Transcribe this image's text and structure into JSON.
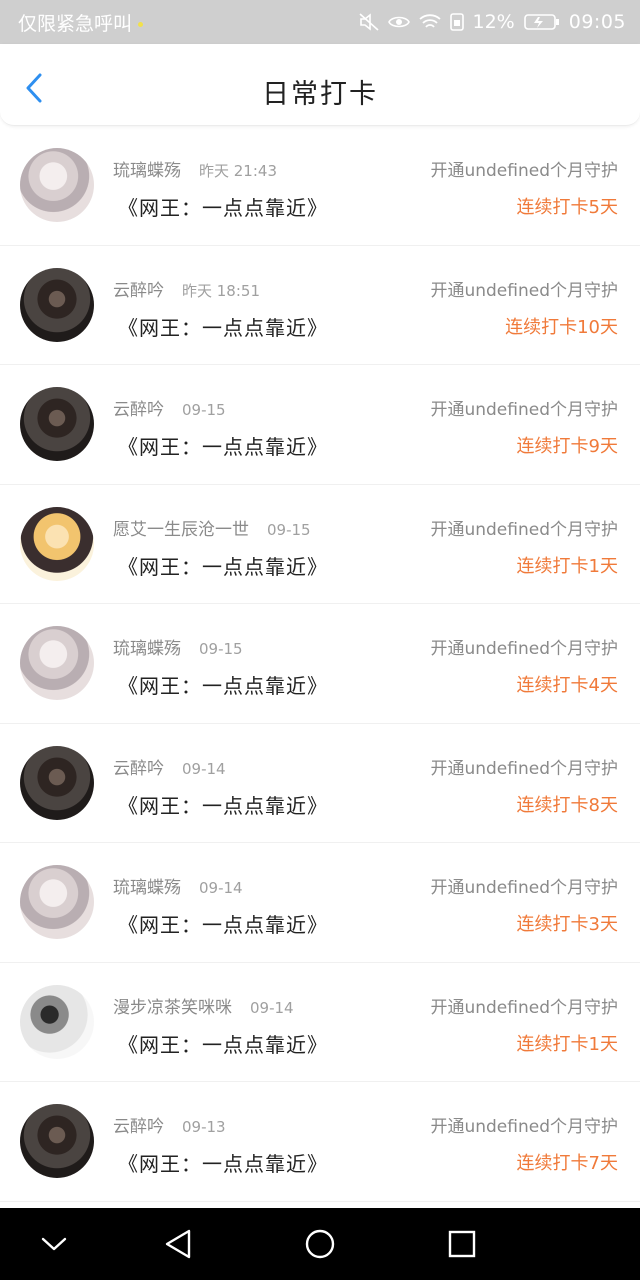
{
  "status_bar": {
    "carrier": "仅限紧急呼叫",
    "battery": "12%",
    "time": "09:05"
  },
  "header": {
    "title": "日常打卡",
    "back_icon": "chevron-left-icon"
  },
  "rows": [
    {
      "user": "琉璃蝶殇",
      "time": "昨天 21:43",
      "guard": "开通undefined个月守护",
      "book": "《网王：一点点靠近》",
      "streak": "连续打卡5天",
      "avatar": "style-1"
    },
    {
      "user": "云醉吟",
      "time": "昨天 18:51",
      "guard": "开通undefined个月守护",
      "book": "《网王：一点点靠近》",
      "streak": "连续打卡10天",
      "avatar": "style-2"
    },
    {
      "user": "云醉吟",
      "time": "09-15",
      "guard": "开通undefined个月守护",
      "book": "《网王：一点点靠近》",
      "streak": "连续打卡9天",
      "avatar": "style-2"
    },
    {
      "user": "愿艾一生辰沧一世",
      "time": "09-15",
      "guard": "开通undefined个月守护",
      "book": "《网王：一点点靠近》",
      "streak": "连续打卡1天",
      "avatar": "style-3"
    },
    {
      "user": "琉璃蝶殇",
      "time": "09-15",
      "guard": "开通undefined个月守护",
      "book": "《网王：一点点靠近》",
      "streak": "连续打卡4天",
      "avatar": "style-1"
    },
    {
      "user": "云醉吟",
      "time": "09-14",
      "guard": "开通undefined个月守护",
      "book": "《网王：一点点靠近》",
      "streak": "连续打卡8天",
      "avatar": "style-2"
    },
    {
      "user": "琉璃蝶殇",
      "time": "09-14",
      "guard": "开通undefined个月守护",
      "book": "《网王：一点点靠近》",
      "streak": "连续打卡3天",
      "avatar": "style-1"
    },
    {
      "user": "漫步凉茶笑咪咪",
      "time": "09-14",
      "guard": "开通undefined个月守护",
      "book": "《网王：一点点靠近》",
      "streak": "连续打卡1天",
      "avatar": "style-4"
    },
    {
      "user": "云醉吟",
      "time": "09-13",
      "guard": "开通undefined个月守护",
      "book": "《网王：一点点靠近》",
      "streak": "连续打卡7天",
      "avatar": "style-2"
    }
  ],
  "colors": {
    "accent_blue": "#2e8ff0",
    "streak_orange": "#f07a3a"
  }
}
